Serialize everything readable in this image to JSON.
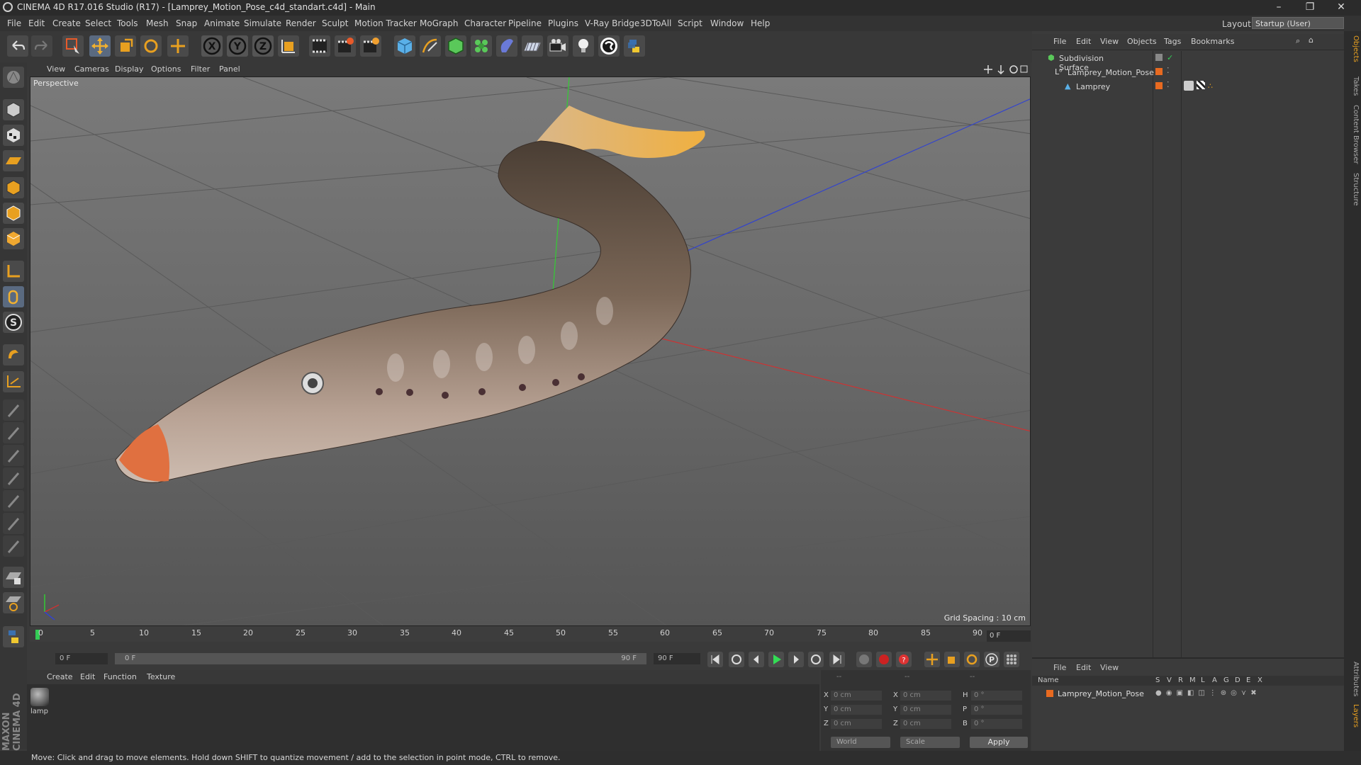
{
  "window": {
    "title": "CINEMA 4D R17.016 Studio (R17) - [Lamprey_Motion_Pose_c4d_standart.c4d] - Main",
    "controls": [
      "–",
      "❐",
      "✕"
    ]
  },
  "menubar": [
    "File",
    "Edit",
    "Create",
    "Select",
    "Tools",
    "Mesh",
    "Snap",
    "Animate",
    "Simulate",
    "Render",
    "Sculpt",
    "Motion Tracker",
    "MoGraph",
    "Character",
    "Pipeline",
    "Plugins",
    "V-Ray Bridge",
    "3DToAll",
    "Script",
    "Window",
    "Help"
  ],
  "layout": {
    "label": "Layout:",
    "value": "Startup (User)"
  },
  "toolbar": {
    "axis_buttons": [
      "X",
      "Y",
      "Z"
    ]
  },
  "viewport": {
    "menu": [
      "View",
      "Cameras",
      "Display",
      "Options",
      "Filter",
      "Panel"
    ],
    "camera_label": "Perspective",
    "grid_spacing": "Grid Spacing : 10 cm"
  },
  "timeline": {
    "ticks": [
      "0",
      "5",
      "10",
      "15",
      "20",
      "25",
      "30",
      "35",
      "40",
      "45",
      "50",
      "55",
      "60",
      "65",
      "70",
      "75",
      "80",
      "85",
      "90"
    ],
    "current_frame": "0 F",
    "start_field": "0 F",
    "range_start": "0 F",
    "range_end": "90 F",
    "end_field": "90 F"
  },
  "material_manager": {
    "menu": [
      "Create",
      "Edit",
      "Function",
      "Texture"
    ],
    "materials": [
      {
        "name": "lamp"
      }
    ]
  },
  "coordinates": {
    "headers": [
      "--",
      "--",
      "--"
    ],
    "rows": [
      {
        "a": "X",
        "av": "0 cm",
        "b": "X",
        "bv": "0 cm",
        "c": "H",
        "cv": "0 °"
      },
      {
        "a": "Y",
        "av": "0 cm",
        "b": "Y",
        "bv": "0 cm",
        "c": "P",
        "cv": "0 °"
      },
      {
        "a": "Z",
        "av": "0 cm",
        "b": "Z",
        "bv": "0 cm",
        "c": "B",
        "cv": "0 °"
      }
    ],
    "mode_world": "World",
    "mode_scale": "Scale",
    "apply": "Apply"
  },
  "object_manager": {
    "menu": [
      "File",
      "Edit",
      "View",
      "Objects",
      "Tags",
      "Bookmarks"
    ],
    "objects": [
      {
        "name": "Subdivision Surface"
      },
      {
        "name": "Lamprey_Motion_Pose"
      },
      {
        "name": "Lamprey"
      }
    ]
  },
  "side_tabs": [
    "Objects",
    "Takes",
    "Content Browser",
    "Structure"
  ],
  "side_tabs_bottom": [
    "Attributes",
    "Layers"
  ],
  "layer_manager": {
    "menu": [
      "File",
      "Edit",
      "View"
    ],
    "columns": [
      "Name",
      "S",
      "V",
      "R",
      "M",
      "L",
      "A",
      "G",
      "D",
      "E",
      "X"
    ],
    "rows": [
      {
        "name": "Lamprey_Motion_Pose"
      }
    ]
  },
  "brand": "MAXON CINEMA 4D",
  "status": "Move: Click and drag to move elements. Hold down SHIFT to quantize movement / add to the selection in point mode, CTRL to remove."
}
